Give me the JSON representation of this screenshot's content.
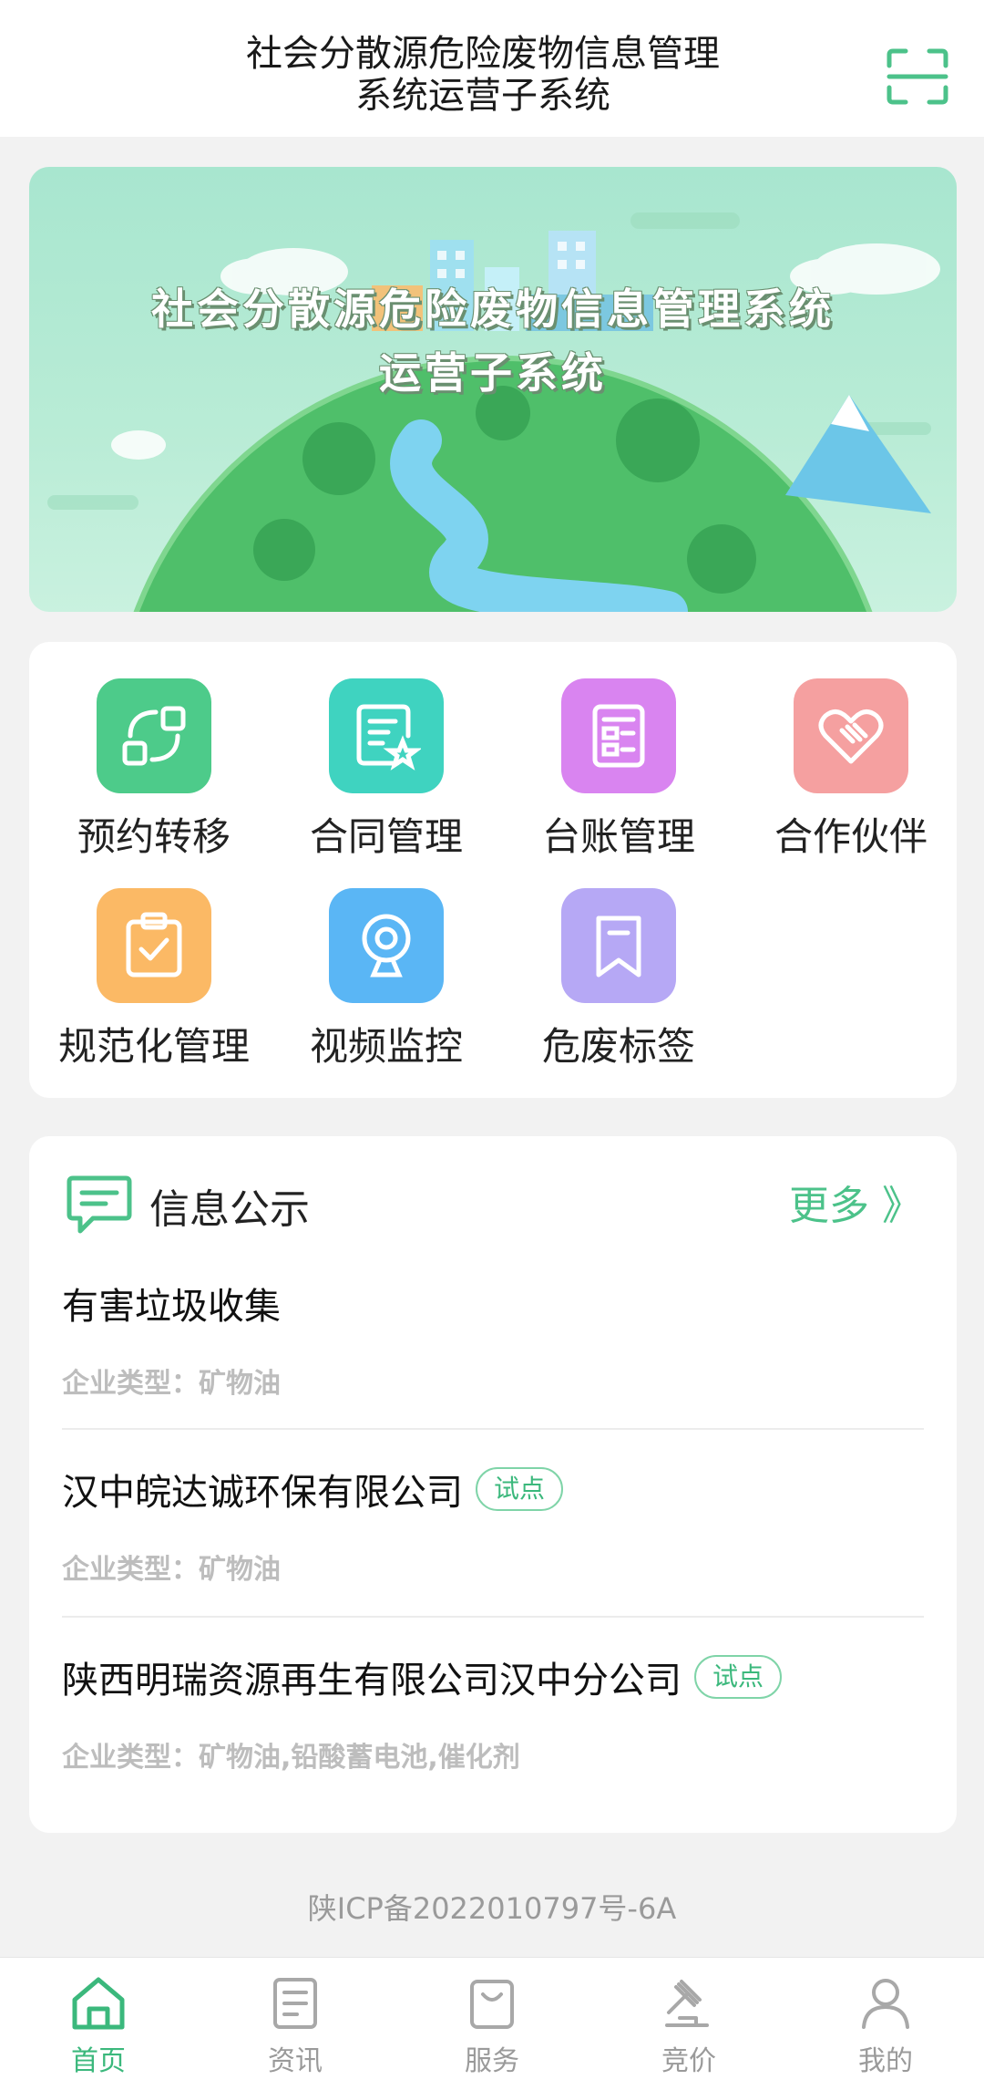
{
  "header": {
    "title_line1": "社会分散源危险废物信息管理",
    "title_line2": "系统运营子系统",
    "scan_icon": "scan-icon"
  },
  "banner": {
    "line1": "社会分散源危险废物信息管理系统",
    "line2": "运营子系统"
  },
  "grid": {
    "items": [
      {
        "label": "预约转移",
        "icon": "transfer-icon",
        "color": "#4dcb8a"
      },
      {
        "label": "合同管理",
        "icon": "contract-icon",
        "color": "#3fd3c0"
      },
      {
        "label": "台账管理",
        "icon": "ledger-icon",
        "color": "#d984f0"
      },
      {
        "label": "合作伙伴",
        "icon": "handshake-heart-icon",
        "color": "#f5a0a0"
      },
      {
        "label": "规范化管理",
        "icon": "clipboard-check-icon",
        "color": "#fbb965"
      },
      {
        "label": "视频监控",
        "icon": "webcam-icon",
        "color": "#5ab6f5"
      },
      {
        "label": "危废标签",
        "icon": "bookmark-icon",
        "color": "#b6a8f5"
      }
    ]
  },
  "info": {
    "title": "信息公示",
    "more": "更多 》",
    "items": [
      {
        "name": "有害垃圾收集",
        "badge": "",
        "type": "企业类型：矿物油"
      },
      {
        "name": "汉中皖达诚环保有限公司",
        "badge": "试点",
        "type": "企业类型：矿物油"
      },
      {
        "name": "陕西明瑞资源再生有限公司汉中分公司",
        "badge": "试点",
        "type": "企业类型：矿物油,铅酸蓄电池,催化剂"
      }
    ]
  },
  "footer": {
    "icp": "陕ICP备2022010797号-6A"
  },
  "tabbar": {
    "tabs": [
      {
        "label": "首页",
        "icon": "home-icon",
        "active": true
      },
      {
        "label": "资讯",
        "icon": "news-icon",
        "active": false
      },
      {
        "label": "服务",
        "icon": "service-bag-icon",
        "active": false
      },
      {
        "label": "竞价",
        "icon": "auction-gavel-icon",
        "active": false
      },
      {
        "label": "我的",
        "icon": "user-icon",
        "active": false
      }
    ]
  },
  "colors": {
    "accent": "#3bb87c",
    "background": "#f2f2f2"
  }
}
